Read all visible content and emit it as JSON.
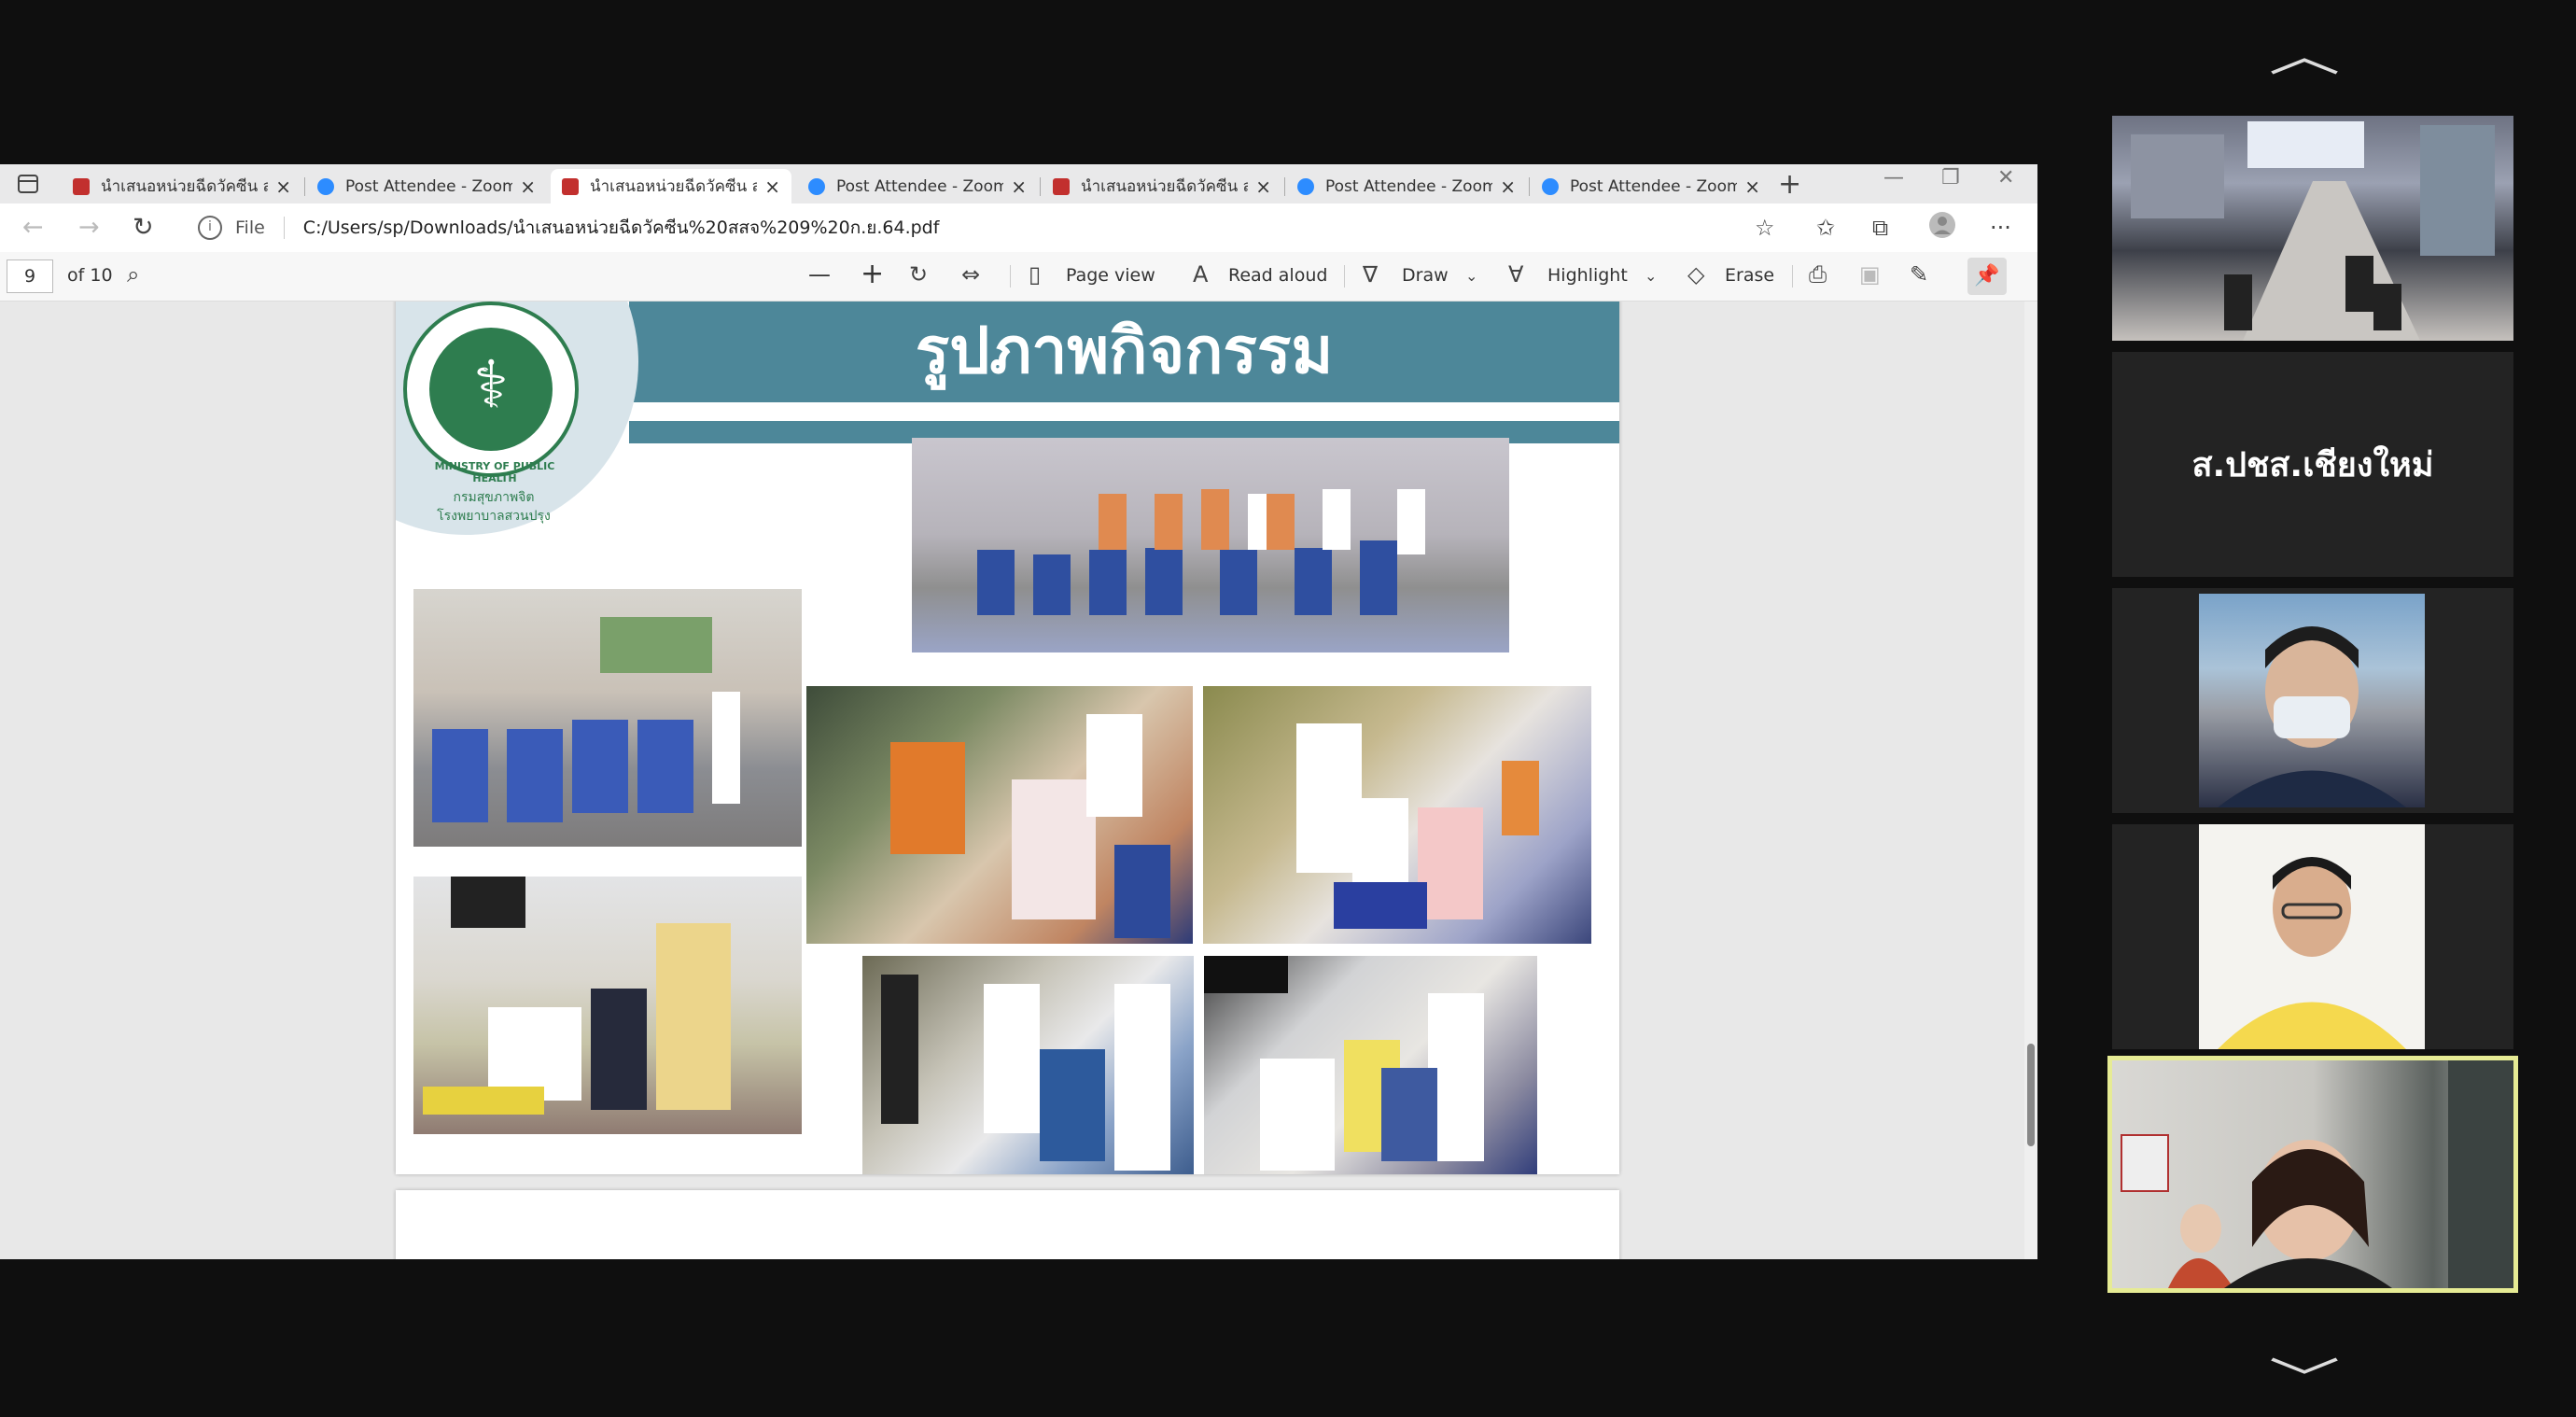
{
  "browser": {
    "tabs": [
      {
        "label": "นำเสนอหน่วยฉีดวัคซีน สสจ",
        "type": "pdf",
        "active": false
      },
      {
        "label": "Post Attendee - Zoom",
        "type": "zoom",
        "active": false
      },
      {
        "label": "นำเสนอหน่วยฉีดวัคซีน สสจ",
        "type": "pdf",
        "active": true
      },
      {
        "label": "Post Attendee - Zoom",
        "type": "zoom",
        "active": false
      },
      {
        "label": "นำเสนอหน่วยฉีดวัคซีน สสจ",
        "type": "pdf",
        "active": false
      },
      {
        "label": "Post Attendee - Zoom",
        "type": "zoom",
        "active": false
      },
      {
        "label": "Post Attendee - Zoom",
        "type": "zoom",
        "active": false
      }
    ],
    "close_glyph": "×",
    "new_tab": "+",
    "window_buttons": {
      "minimize": "—",
      "restore": "❐",
      "close": "✕"
    },
    "address": {
      "file_label": "File",
      "url": "C:/Users/sp/Downloads/นำเสนอหน่วยฉีดวัคซีน%20สสจ%209%20ก.ย.64.pdf"
    },
    "nav": {
      "back": "←",
      "forward": "→",
      "reload": "↻"
    }
  },
  "pdf_toolbar": {
    "page_number": "9",
    "page_total": "of 10",
    "zoom_out": "—",
    "zoom_in": "+",
    "page_view": "Page view",
    "read_aloud": "Read aloud",
    "draw": "Draw",
    "highlight": "Highlight",
    "erase": "Erase"
  },
  "slide": {
    "title": "รูปภาพกิจกรรม",
    "logo_text": "MINISTRY OF PUBLIC HEALTH",
    "dept_line1": "กรมสุขภาพจิต",
    "dept_line2": "โรงพยาบาลสวนปรุง"
  },
  "zoom": {
    "participants": [
      {
        "name": "",
        "kind": "room"
      },
      {
        "name": "ส.ปชส.เชียงใหม่",
        "kind": "name"
      },
      {
        "name": "",
        "kind": "person-mask"
      },
      {
        "name": "",
        "kind": "person-yellow"
      },
      {
        "name": "",
        "kind": "speaker"
      }
    ],
    "up_arrow": "︿",
    "down_arrow": "﹀"
  },
  "colors": {
    "banner": "#4d8799",
    "speaking_border": "#e6eb94",
    "logo_green": "#2e7d4f"
  }
}
